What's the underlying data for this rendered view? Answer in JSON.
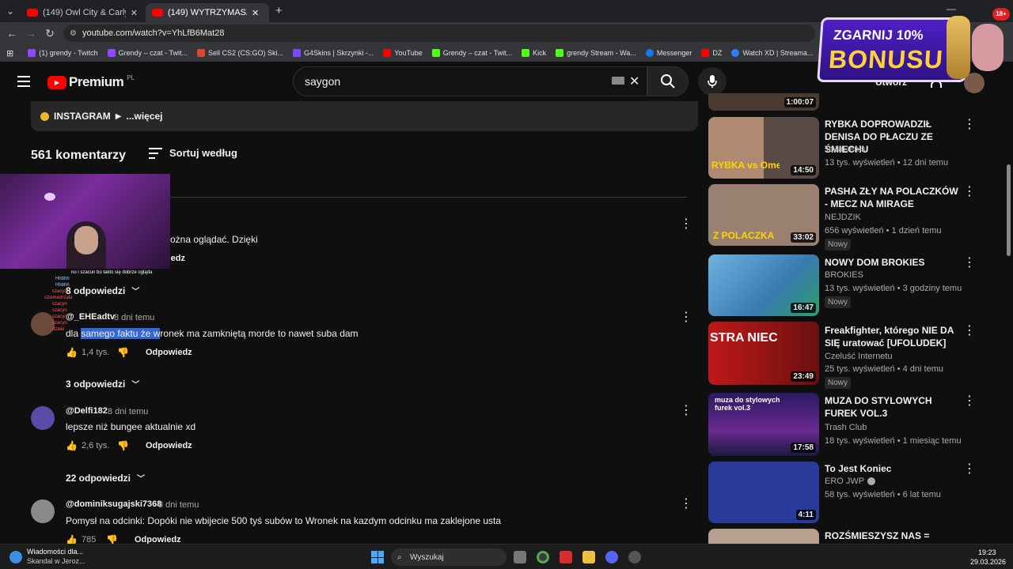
{
  "tabs": [
    {
      "label": "(149) Owl City & Carly Rae Jeps"
    },
    {
      "label": "(149) WYTRZYMASZ NOC W"
    }
  ],
  "address": {
    "url": "youtube.com/watch?v=YhLfB6Mat28"
  },
  "bookmarks": [
    {
      "label": "(1) grendy - Twitch",
      "color": "#9146ff"
    },
    {
      "label": "Grendy – czat - Twit...",
      "color": "#9146ff"
    },
    {
      "label": "Sell CS2 (CS:GO) Ski...",
      "color": "#e0452f"
    },
    {
      "label": "G4Skins | Skrzynki -...",
      "color": "#7a4cff"
    },
    {
      "label": "YouTube",
      "color": "#ff0000"
    },
    {
      "label": "Grendy – czat - Twit...",
      "color": "#53fc18"
    },
    {
      "label": "Kick",
      "color": "#53fc18"
    },
    {
      "label": "grendy Stream - Wa...",
      "color": "#53fc18"
    },
    {
      "label": "Messenger",
      "color": "#1877f2"
    },
    {
      "label": "DZ",
      "color": "#ff0000"
    },
    {
      "label": "Watch XD | Streama...",
      "color": "#2f7bff"
    }
  ],
  "youtube": {
    "logo": "Premium",
    "region": "PL",
    "search_value": "saygon",
    "create_label": "Utwórz"
  },
  "description": {
    "instagram": "INSTAGRAM",
    "more": "...więcej"
  },
  "comments_header": {
    "count": "561 komentarzy",
    "sort": "Sortuj według"
  },
  "comments": [
    {
      "text": "ożna oglądać. Dzięki",
      "reply_label": "dziedz",
      "replies": "8 odpowiedzi"
    },
    {
      "author": "@_EHEadtv",
      "time": "8 dni temu",
      "text_pre": "dla ",
      "text_hl": "samego faktu że w",
      "text_post": "ronek ma zamkniętą morde to nawet suba dam",
      "likes": "1,4 tys.",
      "reply_label": "Odpowiedz",
      "replies": "3 odpowiedzi"
    },
    {
      "author": "@Delfi182",
      "time": "8 dni temu",
      "text": "lepsze niż bungee aktualnie xd",
      "likes": "2,6 tys.",
      "reply_label": "Odpowiedz",
      "replies": "22 odpowiedzi"
    },
    {
      "author": "@dominiksugajski7368",
      "time": "8 dni temu",
      "text": "Pomysł na odcinki: Dopóki nie wbijecie 500 tyś subów to Wronek na kazdym odcinku ma zaklejone usta",
      "likes": "785",
      "reply_label": "Odpowiedz"
    }
  ],
  "stream_chat": [
    "no i szacun bo takto się dobrze ogląda",
    "Hhbhh",
    "Hhbhh",
    "szacyn",
    "sziemedrzala",
    "szacyn",
    "szacyn",
    "szacyn",
    "szacyn",
    "dzieki"
  ],
  "related": [
    {
      "duration": "1:00:07"
    },
    {
      "title": "RYBKA DOPROWADZIŁ DENISA DO PŁACZU ZE ŚMIECHU",
      "channel": "ToJaDenis",
      "meta": "13 tys. wyświetleń • 12 dni temu",
      "duration": "14:50",
      "overlay": "RYBKA vs Ome.tv"
    },
    {
      "title": "PASHA ZŁY NA POLACZKÓW - MECZ NA MIRAGE",
      "channel": "NEJDZIK",
      "meta": "656 wyświetleń • 1 dzień temu",
      "badge": "Nowy",
      "duration": "33:02",
      "overlay": "Z POLACZKA"
    },
    {
      "title": "NOWY DOM BROKIES",
      "channel": "BROKIES",
      "meta": "13 tys. wyświetleń • 3 godziny temu",
      "badge": "Nowy",
      "duration": "16:47"
    },
    {
      "title": "Freakfighter, którego NIE DA SIĘ uratować [UFOLUDEK]",
      "channel": "Czeluść Internetu",
      "meta": "25 tys. wyświetleń • 4 dni temu",
      "badge": "Nowy",
      "duration": "23:49",
      "overlay": "STRA NIEC"
    },
    {
      "title": "MUZA DO STYLOWYCH FUREK VOL.3",
      "channel": "Trash Club",
      "meta": "18 tys. wyświetleń • 1 miesiąc temu",
      "duration": "17:58",
      "overlay": "muza do stylowych furek vol.3"
    },
    {
      "title": "To Jest Koniec",
      "channel": "ERO JWP",
      "meta": "58 tys. wyświetleń • 6 lat temu",
      "duration": "4:11"
    },
    {
      "title": "ROZŚMIESZYSZ NAS ="
    }
  ],
  "promo": {
    "line1": "ZGARNIJ 10%",
    "line2": "BONUSU",
    "badge": "18+"
  },
  "taskbar": {
    "weather_title": "Wiadomości dla...",
    "weather_sub": "Skandal w Jeroz...",
    "search": "Wyszukaj",
    "time": "19:23",
    "date": "29.03.2026"
  }
}
